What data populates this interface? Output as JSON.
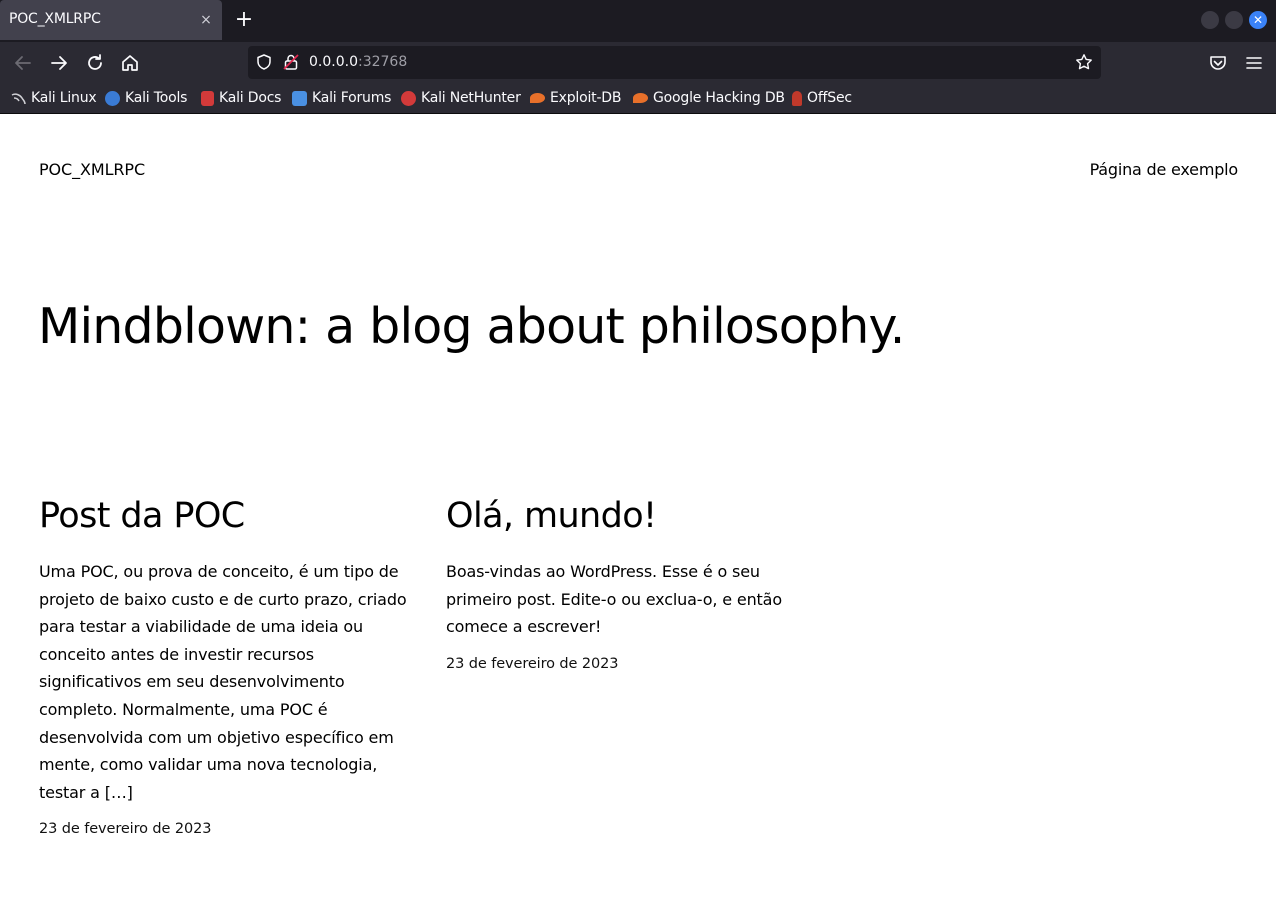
{
  "browser": {
    "tab_title": "POC_XMLRPC",
    "tab_close_glyph": "×",
    "newtab_glyph": "+",
    "url_host": "0.0.0.0",
    "url_port": ":32768",
    "bookmarks": [
      {
        "label": "Kali Linux",
        "icon": "kali-dragon-icon",
        "color": "#cccccc"
      },
      {
        "label": "Kali Tools",
        "icon": "kali-tools-icon",
        "color": "#3a7bd5"
      },
      {
        "label": "Kali Docs",
        "icon": "kali-docs-icon",
        "color": "#d33a3a"
      },
      {
        "label": "Kali Forums",
        "icon": "kali-forums-icon",
        "color": "#4a90e2"
      },
      {
        "label": "Kali NetHunter",
        "icon": "nethunter-icon",
        "color": "#d33a3a"
      },
      {
        "label": "Exploit-DB",
        "icon": "exploit-db-icon",
        "color": "#e8702a"
      },
      {
        "label": "Google Hacking DB",
        "icon": "ghdb-icon",
        "color": "#e8702a"
      },
      {
        "label": "OffSec",
        "icon": "offsec-icon",
        "color": "#c0392b"
      }
    ]
  },
  "site": {
    "title": "POC_XMLRPC",
    "nav_link": "Página de exemplo",
    "hero": "Mindblown: a blog about philosophy."
  },
  "posts": [
    {
      "title": "Post da POC",
      "excerpt": "Uma POC, ou prova de conceito, é um tipo de projeto de baixo custo e de curto prazo, criado para testar a viabilidade de uma ideia ou conceito antes de investir recursos significativos em seu desenvolvimento completo. Normalmente, uma POC é desenvolvida com um objetivo específico em mente, como validar uma nova tecnologia, testar a […]",
      "date": "23 de fevereiro de 2023"
    },
    {
      "title": "Olá, mundo!",
      "excerpt": "Boas-vindas ao WordPress. Esse é o seu primeiro post. Edite-o ou exclua-o, e então comece a escrever!",
      "date": "23 de fevereiro de 2023"
    }
  ]
}
